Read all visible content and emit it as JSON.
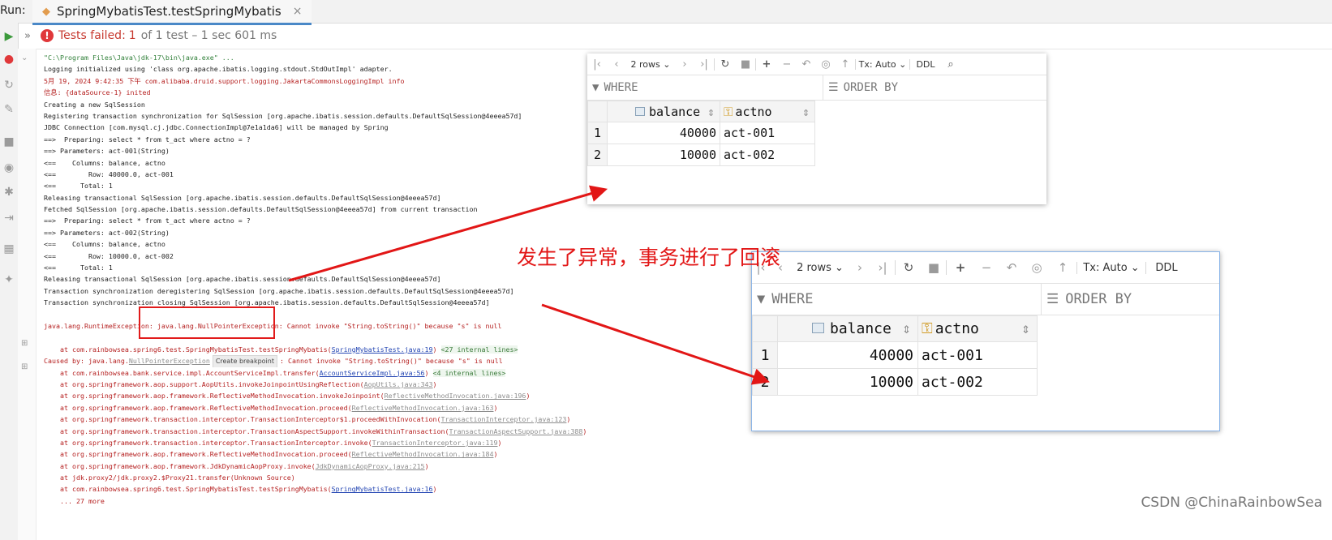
{
  "run_label": "Run:",
  "tab": {
    "title": "SpringMybatisTest.testSpringMybatis",
    "close": "×"
  },
  "status": {
    "tests_failed_label": "Tests failed:",
    "failed_count": "1",
    "summary": "of 1 test – 1 sec 601 ms"
  },
  "console": {
    "lines": [
      "\"C:\\Program Files\\Java\\jdk-17\\bin\\java.exe\" ...",
      "Logging initialized using 'class org.apache.ibatis.logging.stdout.StdOutImpl' adapter.",
      "5月 19, 2024 9:42:35 下午 com.alibaba.druid.support.logging.JakartaCommonsLoggingImpl info",
      "信息: {dataSource-1} inited",
      "Creating a new SqlSession",
      "Registering transaction synchronization for SqlSession [org.apache.ibatis.session.defaults.DefaultSqlSession@4eeea57d]",
      "JDBC Connection [com.mysql.cj.jdbc.ConnectionImpl@7e1a1da6] will be managed by Spring",
      "==>  Preparing: select * from t_act where actno = ?",
      "==> Parameters: act-001(String)",
      "<==    Columns: balance, actno",
      "<==        Row: 40000.0, act-001",
      "<==      Total: 1",
      "Releasing transactional SqlSession [org.apache.ibatis.session.defaults.DefaultSqlSession@4eeea57d]",
      "Fetched SqlSession [org.apache.ibatis.session.defaults.DefaultSqlSession@4eeea57d] from current transaction",
      "==>  Preparing: select * from t_act where actno = ?",
      "==> Parameters: act-002(String)",
      "<==    Columns: balance, actno",
      "<==        Row: 10000.0, act-002",
      "<==      Total: 1",
      "Releasing transactional SqlSession [org.apache.ibatis.session.defaults.DefaultSqlSession@4eeea57d]",
      "Transaction synchronization deregistering SqlSession [org.apache.ibatis.session.defaults.DefaultSqlSession@4eeea57d]",
      "Transaction synchronization closing SqlSession [org.apache.ibatis.session.defaults.DefaultSqlSession@4eeea57d]"
    ],
    "exception_line": "java.lang.RuntimeException: java.lang.NullPointerException: Cannot invoke \"String.toString()\" because \"s\" is null",
    "at1_pre": "    at com.rainbowsea.spring6.test.SpringMybatisTest.testSpringMybatis(",
    "at1_link": "SpringMybatisTest.java:19",
    "at1_post": ") ",
    "at1_internal": "<27 internal lines>",
    "caused_pre": "Caused by: java.lang.",
    "caused_link": "NullPointerException",
    "tooltip": "Create breakpoint",
    "caused_post": ": Cannot invoke \"String.toString()\" because \"s\" is null",
    "at2_pre": "    at com.rainbowsea.bank.service.impl.AccountServiceImpl.transfer(",
    "at2_link": "AccountServiceImpl.java:56",
    "at2_post": ") ",
    "at2_internal": "<4 internal lines>",
    "frames": [
      {
        "pre": "    at org.springframework.aop.support.AopUtils.invokeJoinpointUsingReflection(",
        "link": "AopUtils.java:343",
        "post": ")"
      },
      {
        "pre": "    at org.springframework.aop.framework.ReflectiveMethodInvocation.invokeJoinpoint(",
        "link": "ReflectiveMethodInvocation.java:196",
        "post": ")"
      },
      {
        "pre": "    at org.springframework.aop.framework.ReflectiveMethodInvocation.proceed(",
        "link": "ReflectiveMethodInvocation.java:163",
        "post": ")"
      },
      {
        "pre": "    at org.springframework.transaction.interceptor.TransactionInterceptor$1.proceedWithInvocation(",
        "link": "TransactionInterceptor.java:123",
        "post": ")"
      },
      {
        "pre": "    at org.springframework.transaction.interceptor.TransactionAspectSupport.invokeWithinTransaction(",
        "link": "TransactionAspectSupport.java:388",
        "post": ")"
      },
      {
        "pre": "    at org.springframework.transaction.interceptor.TransactionInterceptor.invoke(",
        "link": "TransactionInterceptor.java:119",
        "post": ")"
      },
      {
        "pre": "    at org.springframework.aop.framework.ReflectiveMethodInvocation.proceed(",
        "link": "ReflectiveMethodInvocation.java:184",
        "post": ")"
      },
      {
        "pre": "    at org.springframework.aop.framework.JdkDynamicAopProxy.invoke(",
        "link": "JdkDynamicAopProxy.java:215",
        "post": ")"
      }
    ],
    "proxy_line": "    at jdk.proxy2/jdk.proxy2.$Proxy21.transfer(Unknown Source)",
    "last_pre": "    at com.rainbowsea.spring6.test.SpringMybatisTest.testSpringMybatis(",
    "last_link": "SpringMybatisTest.java:16",
    "last_post": ")",
    "more": "    ... 27 more"
  },
  "result_panel": {
    "rows_label": "2 rows",
    "tx_label": "Tx: Auto",
    "ddl_label": "DDL",
    "where_label": "WHERE",
    "order_label": "ORDER BY",
    "columns": [
      "balance",
      "actno"
    ],
    "rows": [
      {
        "n": "1",
        "balance": "40000",
        "actno": "act-001"
      },
      {
        "n": "2",
        "balance": "10000",
        "actno": "act-002"
      }
    ]
  },
  "annotation": "发生了异常，事务进行了回滚",
  "watermark": "CSDN @ChinaRainbowSea",
  "colors": {
    "accent_red": "#e21616",
    "link_blue": "#2446b3",
    "fail_red": "#c7392f",
    "tab_underline": "#4a88c7"
  }
}
